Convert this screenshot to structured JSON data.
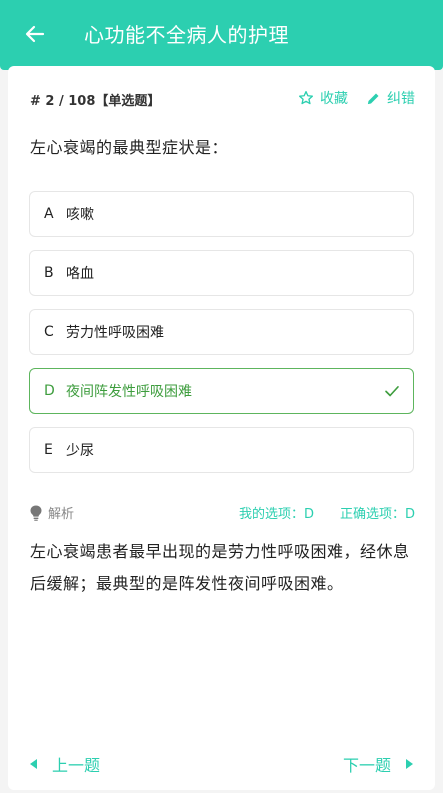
{
  "header": {
    "title": "心功能不全病人的护理"
  },
  "meta": {
    "question_no": "# 2 / 108【单选题】",
    "favorite_label": "收藏",
    "correct_label": "纠错"
  },
  "question": "左心衰竭的最典型症状是：",
  "options": [
    {
      "letter": "A",
      "text": "咳嗽"
    },
    {
      "letter": "B",
      "text": "咯血"
    },
    {
      "letter": "C",
      "text": "劳力性呼吸困难"
    },
    {
      "letter": "D",
      "text": "夜间阵发性呼吸困难",
      "selected": true
    },
    {
      "letter": "E",
      "text": "少尿"
    }
  ],
  "analysis": {
    "label": "解析",
    "my_choice": "我的选项：D",
    "correct_choice": "正确选项：D",
    "text": "左心衰竭患者最早出现的是劳力性呼吸困难，经休息后缓解；最典型的是阵发性夜间呼吸困难。"
  },
  "nav": {
    "prev_label": "上一题",
    "next_label": "下一题"
  },
  "colors": {
    "accent": "#2ccfb0",
    "selected": "#3e9d3e"
  }
}
